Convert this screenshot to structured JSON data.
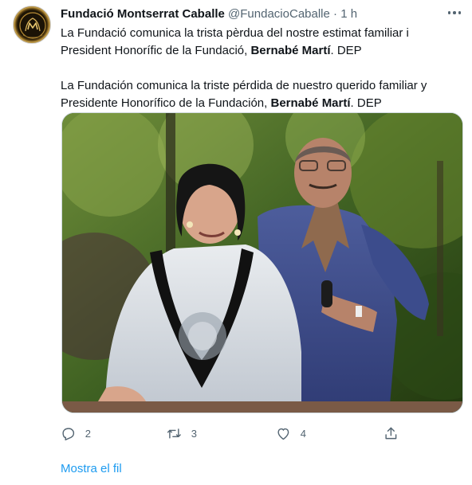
{
  "tweet": {
    "author_name": "Fundació Montserrat Caballe",
    "author_handle": "@FundacioCaballe",
    "separator": "·",
    "timestamp": "1 h",
    "text_ca_part1": "La Fundació comunica la trista pèrdua del nostre estimat familiar i President Honorífic de la Fundació, ",
    "text_ca_bold": "Bernabé Martí",
    "text_ca_end": ". DEP",
    "text_es_part1": "La Fundación comunica la triste pérdida de nuestro querido familiar y Presidente Honorífico de la Fundación, ",
    "text_es_bold": "Bernabé Martí",
    "text_es_end": ". DEP",
    "avatar_icon": "foundation-logo-icon",
    "more_icon": "more-options-icon"
  },
  "actions": {
    "reply_count": "2",
    "retweet_count": "3",
    "like_count": "4",
    "icons": [
      "reply-icon",
      "retweet-icon",
      "like-icon",
      "share-icon"
    ]
  },
  "show_thread_label": "Mostra el fil",
  "colors": {
    "text_primary": "#0f1419",
    "text_secondary": "#536471",
    "link": "#1d9bf0",
    "border": "#cfd9de"
  }
}
